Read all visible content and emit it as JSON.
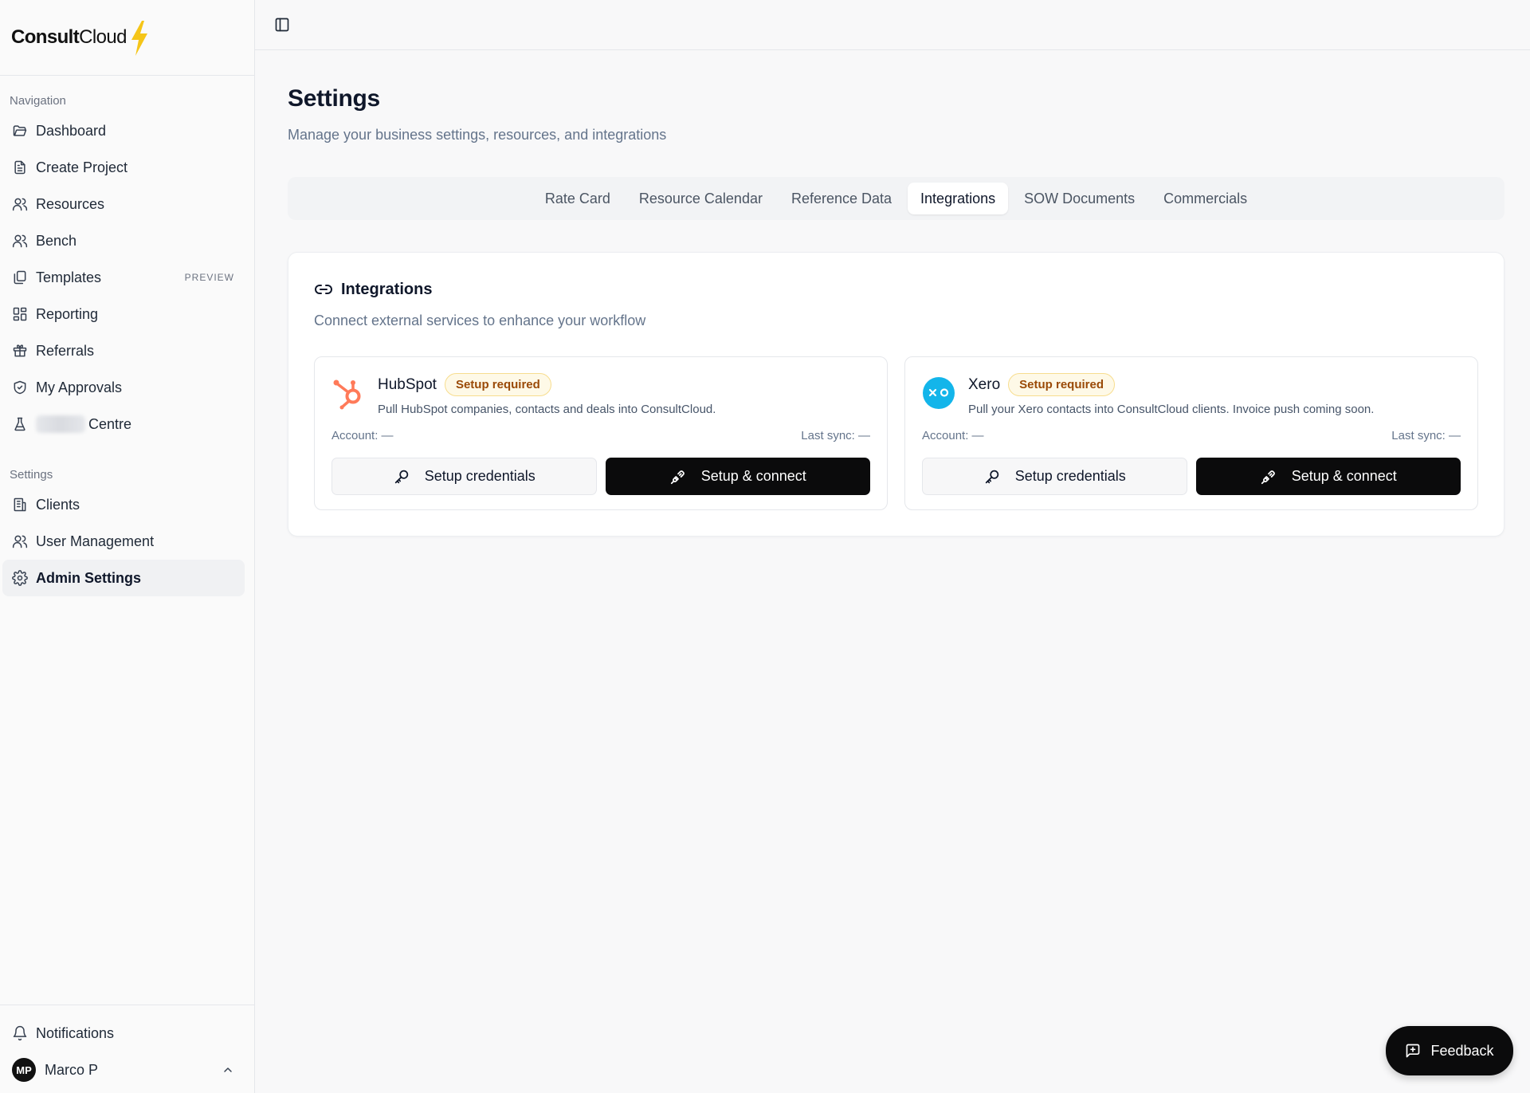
{
  "app": {
    "brand_strong": "Consult",
    "brand_light": "Cloud"
  },
  "sidebar": {
    "nav_label": "Navigation",
    "nav_items": [
      {
        "label": "Dashboard",
        "icon": "folder-open-icon"
      },
      {
        "label": "Create Project",
        "icon": "file-text-icon"
      },
      {
        "label": "Resources",
        "icon": "users-icon"
      },
      {
        "label": "Bench",
        "icon": "users-icon"
      },
      {
        "label": "Templates",
        "icon": "copy-icon",
        "badge": "PREVIEW"
      },
      {
        "label": "Reporting",
        "icon": "layout-dashboard-icon"
      },
      {
        "label": "Referrals",
        "icon": "gift-icon"
      },
      {
        "label": "My Approvals",
        "icon": "shield-check-icon"
      },
      {
        "label": "Centre",
        "icon": "flask-icon"
      }
    ],
    "settings_label": "Settings",
    "settings_items": [
      {
        "label": "Clients",
        "icon": "building-icon"
      },
      {
        "label": "User Management",
        "icon": "users-icon"
      },
      {
        "label": "Admin Settings",
        "icon": "gear-icon",
        "active": true
      }
    ],
    "notifications_label": "Notifications",
    "user": {
      "initials": "MP",
      "name": "Marco P"
    }
  },
  "page": {
    "title": "Settings",
    "subtitle": "Manage your business settings, resources, and integrations"
  },
  "tabs": [
    {
      "label": "Rate Card"
    },
    {
      "label": "Resource Calendar"
    },
    {
      "label": "Reference Data"
    },
    {
      "label": "Integrations",
      "active": true
    },
    {
      "label": "SOW Documents"
    },
    {
      "label": "Commercials"
    }
  ],
  "integrations_card": {
    "title": "Integrations",
    "subtitle": "Connect external services to enhance your workflow",
    "items": [
      {
        "name": "HubSpot",
        "status": "Setup required",
        "description": "Pull HubSpot companies, contacts and deals into ConsultCloud.",
        "account": "Account: —",
        "last_sync": "Last sync: —",
        "credentials_label": "Setup credentials",
        "connect_label": "Setup & connect",
        "brand_color": "#ff7a59"
      },
      {
        "name": "Xero",
        "status": "Setup required",
        "description": "Pull your Xero contacts into ConsultCloud clients. Invoice push coming soon.",
        "account": "Account: —",
        "last_sync": "Last sync: —",
        "credentials_label": "Setup credentials",
        "connect_label": "Setup & connect",
        "brand_color": "#13b5ea"
      }
    ]
  },
  "feedback": {
    "label": "Feedback"
  },
  "colors": {
    "accent_dark": "#0b0b0c",
    "badge_bg": "#fef9e7",
    "badge_text": "#9a4a07",
    "bolt": "#f5c518"
  }
}
